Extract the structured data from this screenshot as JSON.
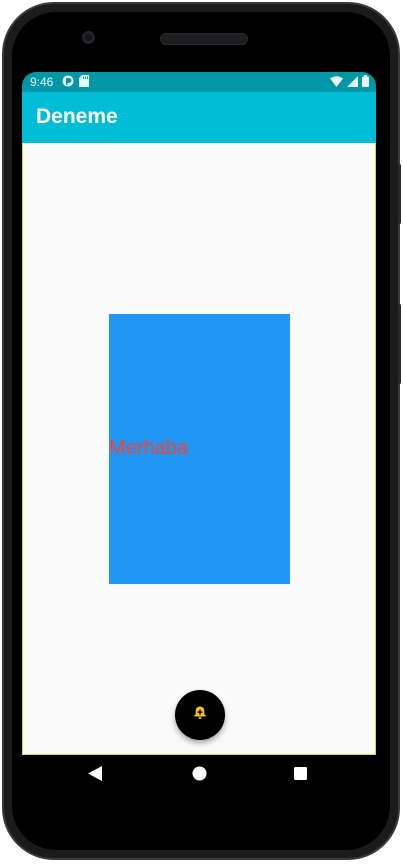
{
  "status_bar": {
    "time": "9:46",
    "left_icons": [
      "debug-icon",
      "sd-card-icon"
    ],
    "right_icons": [
      "wifi-icon",
      "signal-icon",
      "battery-icon"
    ]
  },
  "app_bar": {
    "title": "Deneme"
  },
  "content": {
    "box_text": "Merhaba"
  },
  "fab": {
    "icon": "notification-add-icon"
  },
  "nav_bar": {
    "buttons": [
      "back-icon",
      "home-icon",
      "recents-icon"
    ]
  },
  "colors": {
    "status_bar": "#0097a7",
    "app_bar": "#00bcd4",
    "box": "#2196f3",
    "box_text": "#f44336",
    "fab": "#000000",
    "fab_icon": "#fbc02d"
  }
}
